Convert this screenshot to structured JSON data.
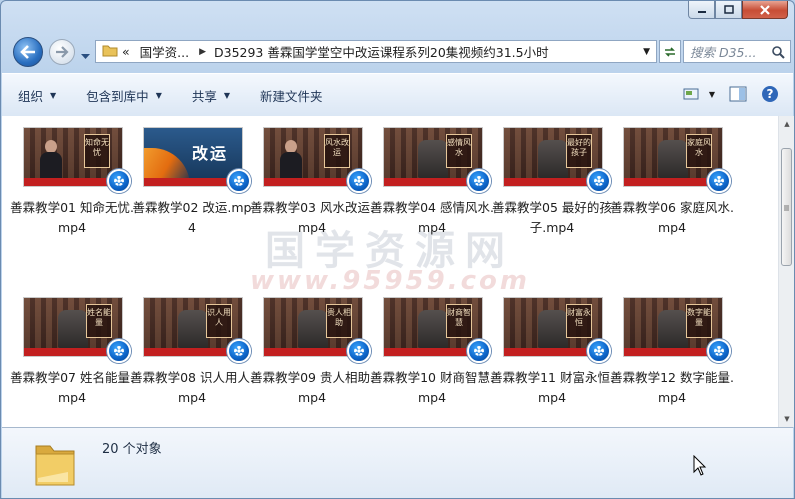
{
  "window": {
    "caption": {
      "minimize": "minimize",
      "maximize": "maximize",
      "close": "close"
    }
  },
  "address": {
    "overflow": "«",
    "segments": [
      "国学资...",
      "D35293 善霖国学堂空中改运课程系列20集视频约31.5小时"
    ]
  },
  "search": {
    "placeholder": "搜索 D35..."
  },
  "toolbar": {
    "organize": "组织",
    "include_library": "包含到库中",
    "share": "共享",
    "new_folder": "新建文件夹"
  },
  "watermark": {
    "line1": "国学资源网",
    "line2": "www.95959.com"
  },
  "files": [
    {
      "name": "善霖教学01 知命无忧.mp4",
      "thumb_text": "知命无忧",
      "style": "person"
    },
    {
      "name": "善霖教学02 改运.mp4",
      "thumb_text": "改运",
      "style": "blue"
    },
    {
      "name": "善霖教学03 风水改运.mp4",
      "thumb_text": "风水改运",
      "style": "person"
    },
    {
      "name": "善霖教学04 感情风水.mp4",
      "thumb_text": "感情风水",
      "style": "chair"
    },
    {
      "name": "善霖教学05 最好的孩子.mp4",
      "thumb_text": "最好的孩子",
      "style": "chair"
    },
    {
      "name": "善霖教学06 家庭风水.mp4",
      "thumb_text": "家庭风水",
      "style": "chair"
    },
    {
      "name": "善霖教学07 姓名能量.mp4",
      "thumb_text": "姓名能量",
      "style": "chair"
    },
    {
      "name": "善霖教学08 识人用人.mp4",
      "thumb_text": "识人用人",
      "style": "chair"
    },
    {
      "name": "善霖教学09 贵人相助.mp4",
      "thumb_text": "贵人相助",
      "style": "chair"
    },
    {
      "name": "善霖教学10 财商智慧.mp4",
      "thumb_text": "财商智慧",
      "style": "chair"
    },
    {
      "name": "善霖教学11 财富永恒.mp4",
      "thumb_text": "财富永恒",
      "style": "chair"
    },
    {
      "name": "善霖教学12 数字能量.mp4",
      "thumb_text": "数字能量",
      "style": "chair"
    }
  ],
  "status": {
    "count": "20 个对象"
  },
  "colors": {
    "accent": "#2a6fc0",
    "thumb_red": "#c21f1f",
    "play_blue": "#0d62c6"
  }
}
